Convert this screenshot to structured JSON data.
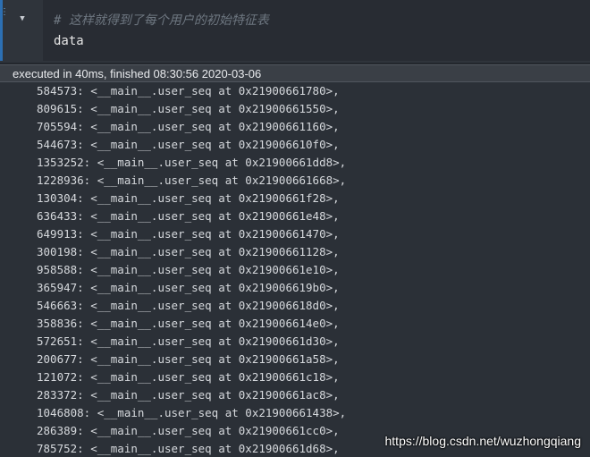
{
  "cell": {
    "comment": "# 这样就得到了每个用户的初始特征表",
    "code": "data",
    "collapse_icon": "caret-down-icon"
  },
  "status": {
    "executed_text": "executed in 40ms, finished 08:30:56 2020-03-06"
  },
  "output": {
    "lines": [
      "584573: <__main__.user_seq at 0x21900661780>,",
      "809615: <__main__.user_seq at 0x21900661550>,",
      "705594: <__main__.user_seq at 0x21900661160>,",
      "544673: <__main__.user_seq at 0x219006610f0>,",
      "1353252: <__main__.user_seq at 0x21900661dd8>,",
      "1228936: <__main__.user_seq at 0x21900661668>,",
      "130304: <__main__.user_seq at 0x21900661f28>,",
      "636433: <__main__.user_seq at 0x21900661e48>,",
      "649913: <__main__.user_seq at 0x21900661470>,",
      "300198: <__main__.user_seq at 0x21900661128>,",
      "958588: <__main__.user_seq at 0x21900661e10>,",
      "365947: <__main__.user_seq at 0x219006619b0>,",
      "546663: <__main__.user_seq at 0x219006618d0>,",
      "358836: <__main__.user_seq at 0x219006614e0>,",
      "572651: <__main__.user_seq at 0x21900661d30>,",
      "200677: <__main__.user_seq at 0x21900661a58>,",
      "121072: <__main__.user_seq at 0x21900661c18>,",
      "283372: <__main__.user_seq at 0x21900661ac8>,",
      "1046808: <__main__.user_seq at 0x21900661438>,",
      "286389: <__main__.user_seq at 0x21900661cc0>,",
      "785752: <__main__.user_seq at 0x21900661d68>,"
    ]
  },
  "watermark": "https://blog.csdn.net/wuzhongqiang"
}
